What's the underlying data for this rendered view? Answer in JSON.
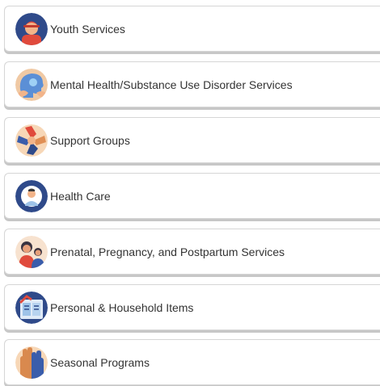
{
  "categories": [
    {
      "label": "Youth Services",
      "icon": "youth-person-icon"
    },
    {
      "label": "Mental Health/Substance Use Disorder Services",
      "icon": "head-heart-icon"
    },
    {
      "label": "Support Groups",
      "icon": "holding-hands-icon"
    },
    {
      "label": "Health Care",
      "icon": "doctor-icon"
    },
    {
      "label": "Prenatal, Pregnancy, and Postpartum Services",
      "icon": "mother-child-icon"
    },
    {
      "label": "Personal & Household Items",
      "icon": "household-items-icon"
    },
    {
      "label": "Seasonal Programs",
      "icon": "raised-hands-icon"
    }
  ]
}
